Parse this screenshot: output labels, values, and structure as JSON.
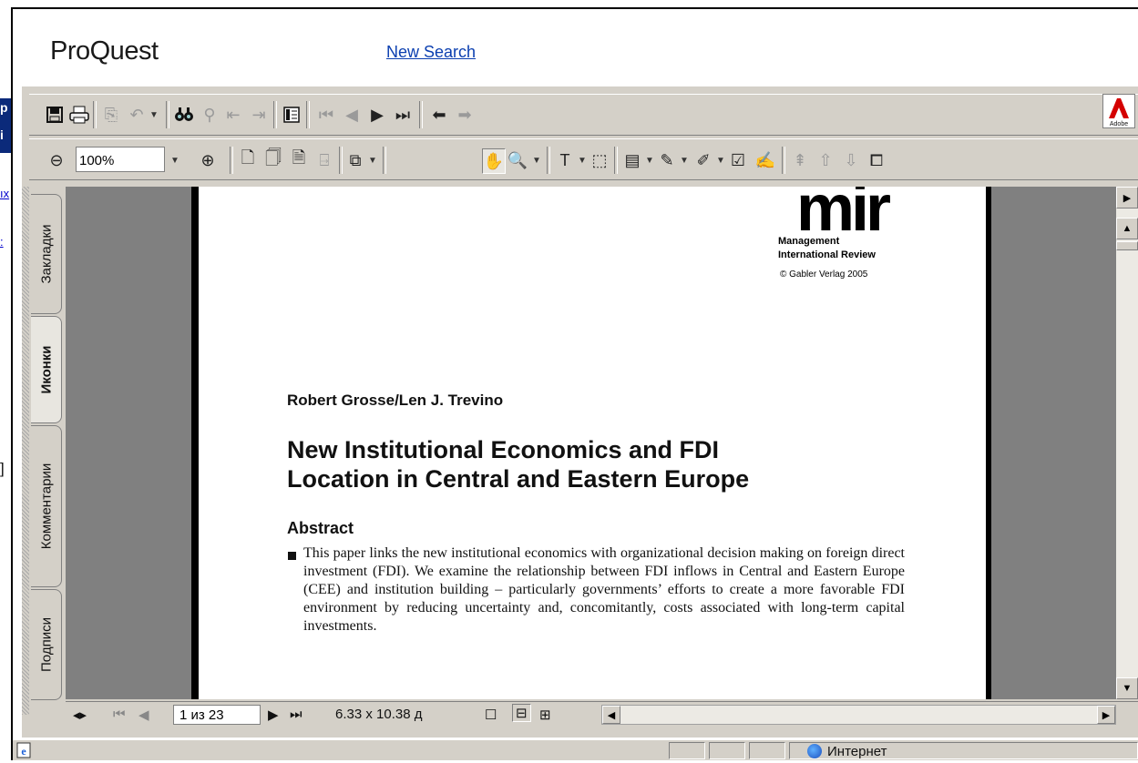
{
  "header": {
    "brand": "ProQuest",
    "new_search": "New Search"
  },
  "background_window": {
    "fragment_1": "р",
    "fragment_2": "i",
    "fragment_3": "ıx",
    "fragment_4": ":",
    "fragment_5": "]"
  },
  "toolbar_top": {
    "icons": [
      "save-icon",
      "print-icon",
      "copy-icon",
      "undo-icon",
      "find-icon",
      "search-text-icon",
      "prev-view-icon",
      "next-view-icon",
      "page-layout-icon",
      "first-page-icon",
      "prev-page-icon",
      "next-page-icon",
      "last-page-icon",
      "back-icon",
      "forward-icon"
    ],
    "adobe_label": "Adobe"
  },
  "toolbar_bottom": {
    "zoom_value": "100%"
  },
  "left_tabs": [
    "Закладки",
    "Иконки",
    "Комментарии",
    "Подписи"
  ],
  "active_tab": "Иконки",
  "document": {
    "logo_text": "mir",
    "logo_sub1": "Management",
    "logo_sub2": "International Review",
    "copyright": "© Gabler Verlag 2005",
    "authors": "Robert Grosse/Len J. Trevino",
    "title_line1": "New Institutional Economics and FDI",
    "title_line2": "Location in Central and Eastern Europe",
    "abstract_heading": "Abstract",
    "abstract_body": "This paper links the new institutional economics with organizational decision making on foreign direct investment (FDI). We examine the relationship between FDI inflows in Central and Eastern Europe (CEE) and institution building – particularly governments’ efforts to create a more favorable FDI environment by reducing uncertainty and, concomitantly, costs associated with long-term capital investments."
  },
  "bottom_nav": {
    "page_indicator": "1 из 23",
    "page_size": "6.33 x 10.38 д"
  },
  "status_bar": {
    "zone": "Интернет"
  }
}
